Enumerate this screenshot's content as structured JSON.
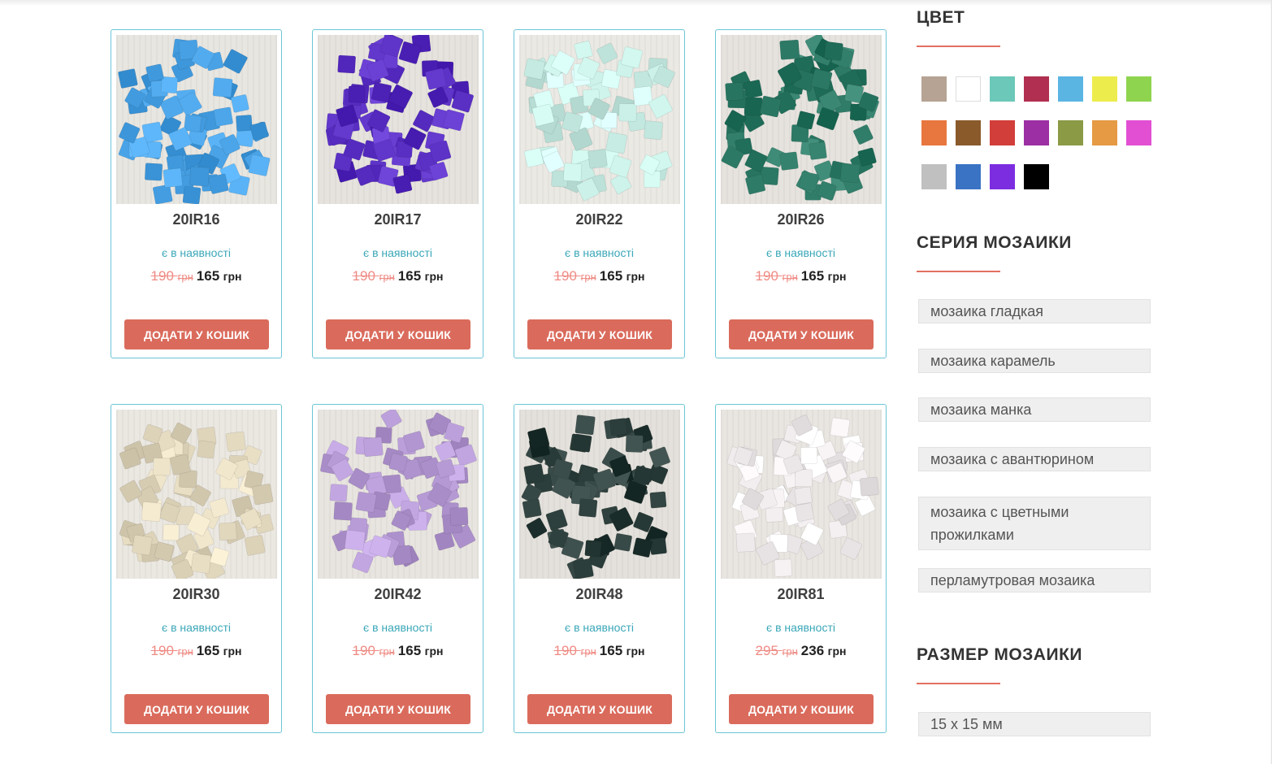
{
  "products": [
    {
      "name": "20IR16",
      "stock": "є в наявності",
      "old_price": "190",
      "old_currency": "грн",
      "new_price": "165",
      "new_currency": "грн",
      "button": "ДОДАТИ У КОШИК",
      "tile_color": "#4aa3e6",
      "bg_color": "#e8e6e1"
    },
    {
      "name": "20IR17",
      "stock": "є в наявності",
      "old_price": "190",
      "old_currency": "грн",
      "new_price": "165",
      "new_currency": "грн",
      "button": "ДОДАТИ У КОШИК",
      "tile_color": "#5a2fc4",
      "bg_color": "#e6e3de"
    },
    {
      "name": "20IR22",
      "stock": "є в наявності",
      "old_price": "190",
      "old_currency": "грн",
      "new_price": "165",
      "new_currency": "грн",
      "button": "ДОДАТИ У КОШИК",
      "tile_color": "#c9efe6",
      "bg_color": "#ebe9e4"
    },
    {
      "name": "20IR26",
      "stock": "є в наявності",
      "old_price": "190",
      "old_currency": "грн",
      "new_price": "165",
      "new_currency": "грн",
      "button": "ДОДАТИ У КОШИК",
      "tile_color": "#2d7a66",
      "bg_color": "#e6e3de"
    },
    {
      "name": "20IR30",
      "stock": "є в наявності",
      "old_price": "190",
      "old_currency": "грн",
      "new_price": "165",
      "new_currency": "грн",
      "button": "ДОДАТИ У КОШИК",
      "tile_color": "#e3d9bf",
      "bg_color": "#ebe8e2"
    },
    {
      "name": "20IR42",
      "stock": "є в наявності",
      "old_price": "190",
      "old_currency": "грн",
      "new_price": "165",
      "new_currency": "грн",
      "button": "ДОДАТИ У КОШИК",
      "tile_color": "#b79bd6",
      "bg_color": "#e8e5e0"
    },
    {
      "name": "20IR48",
      "stock": "є в наявності",
      "old_price": "190",
      "old_currency": "грн",
      "new_price": "165",
      "new_currency": "грн",
      "button": "ДОДАТИ У КОШИК",
      "tile_color": "#2b3d3a",
      "bg_color": "#e4e1dc"
    },
    {
      "name": "20IR81",
      "stock": "є в наявності",
      "old_price": "295",
      "old_currency": "грн",
      "new_price": "236",
      "new_currency": "грн",
      "button": "ДОДАТИ У КОШИК",
      "tile_color": "#f3eef0",
      "bg_color": "#e9e6e1"
    }
  ],
  "sidebar": {
    "color_title": "ЦВЕТ",
    "colors": [
      "#b6a393",
      "#ffffff",
      "#6cc8b9",
      "#b12f50",
      "#5ab5e3",
      "#ecec4c",
      "#8fd44f",
      "#e8773f",
      "#8a5a2b",
      "#d23e3a",
      "#9c2fa3",
      "#8a9a45",
      "#e59a43",
      "#e24fd3",
      "#c0c0c0",
      "#3a73c4",
      "#7d2de0",
      "#000000"
    ],
    "series_title": "СЕРИЯ МОЗАИКИ",
    "series": [
      "мозаика гладкая",
      "мозаика карамель",
      "мозаика манка",
      "мозаика с авантюрином",
      "мозаика с цветными прожилками",
      "перламутровая мозаика"
    ],
    "size_title": "РАЗМЕР МОЗАИКИ",
    "sizes": [
      "15 x 15 мм"
    ]
  }
}
